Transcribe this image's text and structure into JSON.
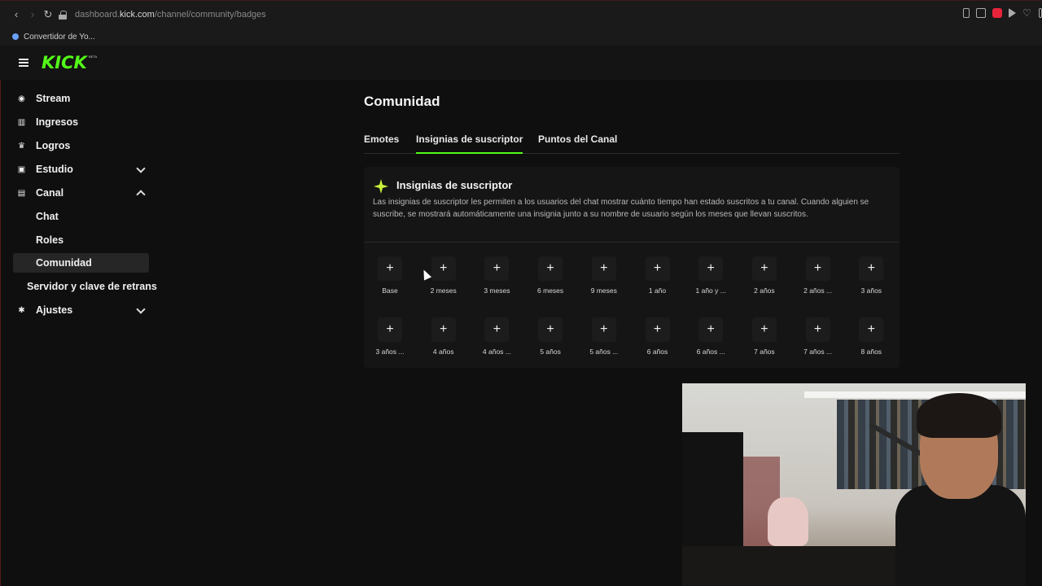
{
  "browser": {
    "url_prefix": "dashboard.",
    "url_host": "kick.com",
    "url_path": "/channel/community/badges",
    "bookmark": "Convertidor de Yo..."
  },
  "header": {
    "logo": "KICK",
    "beta": "BETA"
  },
  "sidebar": {
    "items": [
      {
        "label": "Stream",
        "icon": "broadcast-icon"
      },
      {
        "label": "Ingresos",
        "icon": "chart-icon"
      },
      {
        "label": "Logros",
        "icon": "trophy-icon"
      },
      {
        "label": "Estudio",
        "icon": "studio-icon"
      },
      {
        "label": "Canal",
        "icon": "channel-icon"
      },
      {
        "label": "Chat"
      },
      {
        "label": "Roles"
      },
      {
        "label": "Comunidad"
      },
      {
        "label": "Servidor y clave de retrans"
      },
      {
        "label": "Ajustes",
        "icon": "gear-icon"
      }
    ]
  },
  "main": {
    "title": "Comunidad",
    "tabs": [
      "Emotes",
      "Insignias de suscriptor",
      "Puntos del Canal"
    ],
    "panel": {
      "title": "Insignias de suscriptor",
      "description": "Las insignias de suscriptor les permiten a los usuarios del chat mostrar cuánto tiempo han estado suscritos a tu canal. Cuando alguien se suscribe, se mostrará automáticamente una insignia junto a su nombre de usuario según los meses que llevan suscritos.",
      "add_symbol": "+",
      "row1": [
        "Base",
        "2 meses",
        "3 meses",
        "6 meses",
        "9 meses",
        "1 año",
        "1 año y ...",
        "2 años",
        "2 años ...",
        "3 años"
      ],
      "row2": [
        "3 años ...",
        "4 años",
        "4 años ...",
        "5 años",
        "5 años ...",
        "6 años",
        "6 años ...",
        "7 años",
        "7 años ...",
        "8 años"
      ]
    }
  },
  "colors": {
    "accent": "#53fc18",
    "background": "#0f0f0f",
    "panel": "#151515"
  }
}
